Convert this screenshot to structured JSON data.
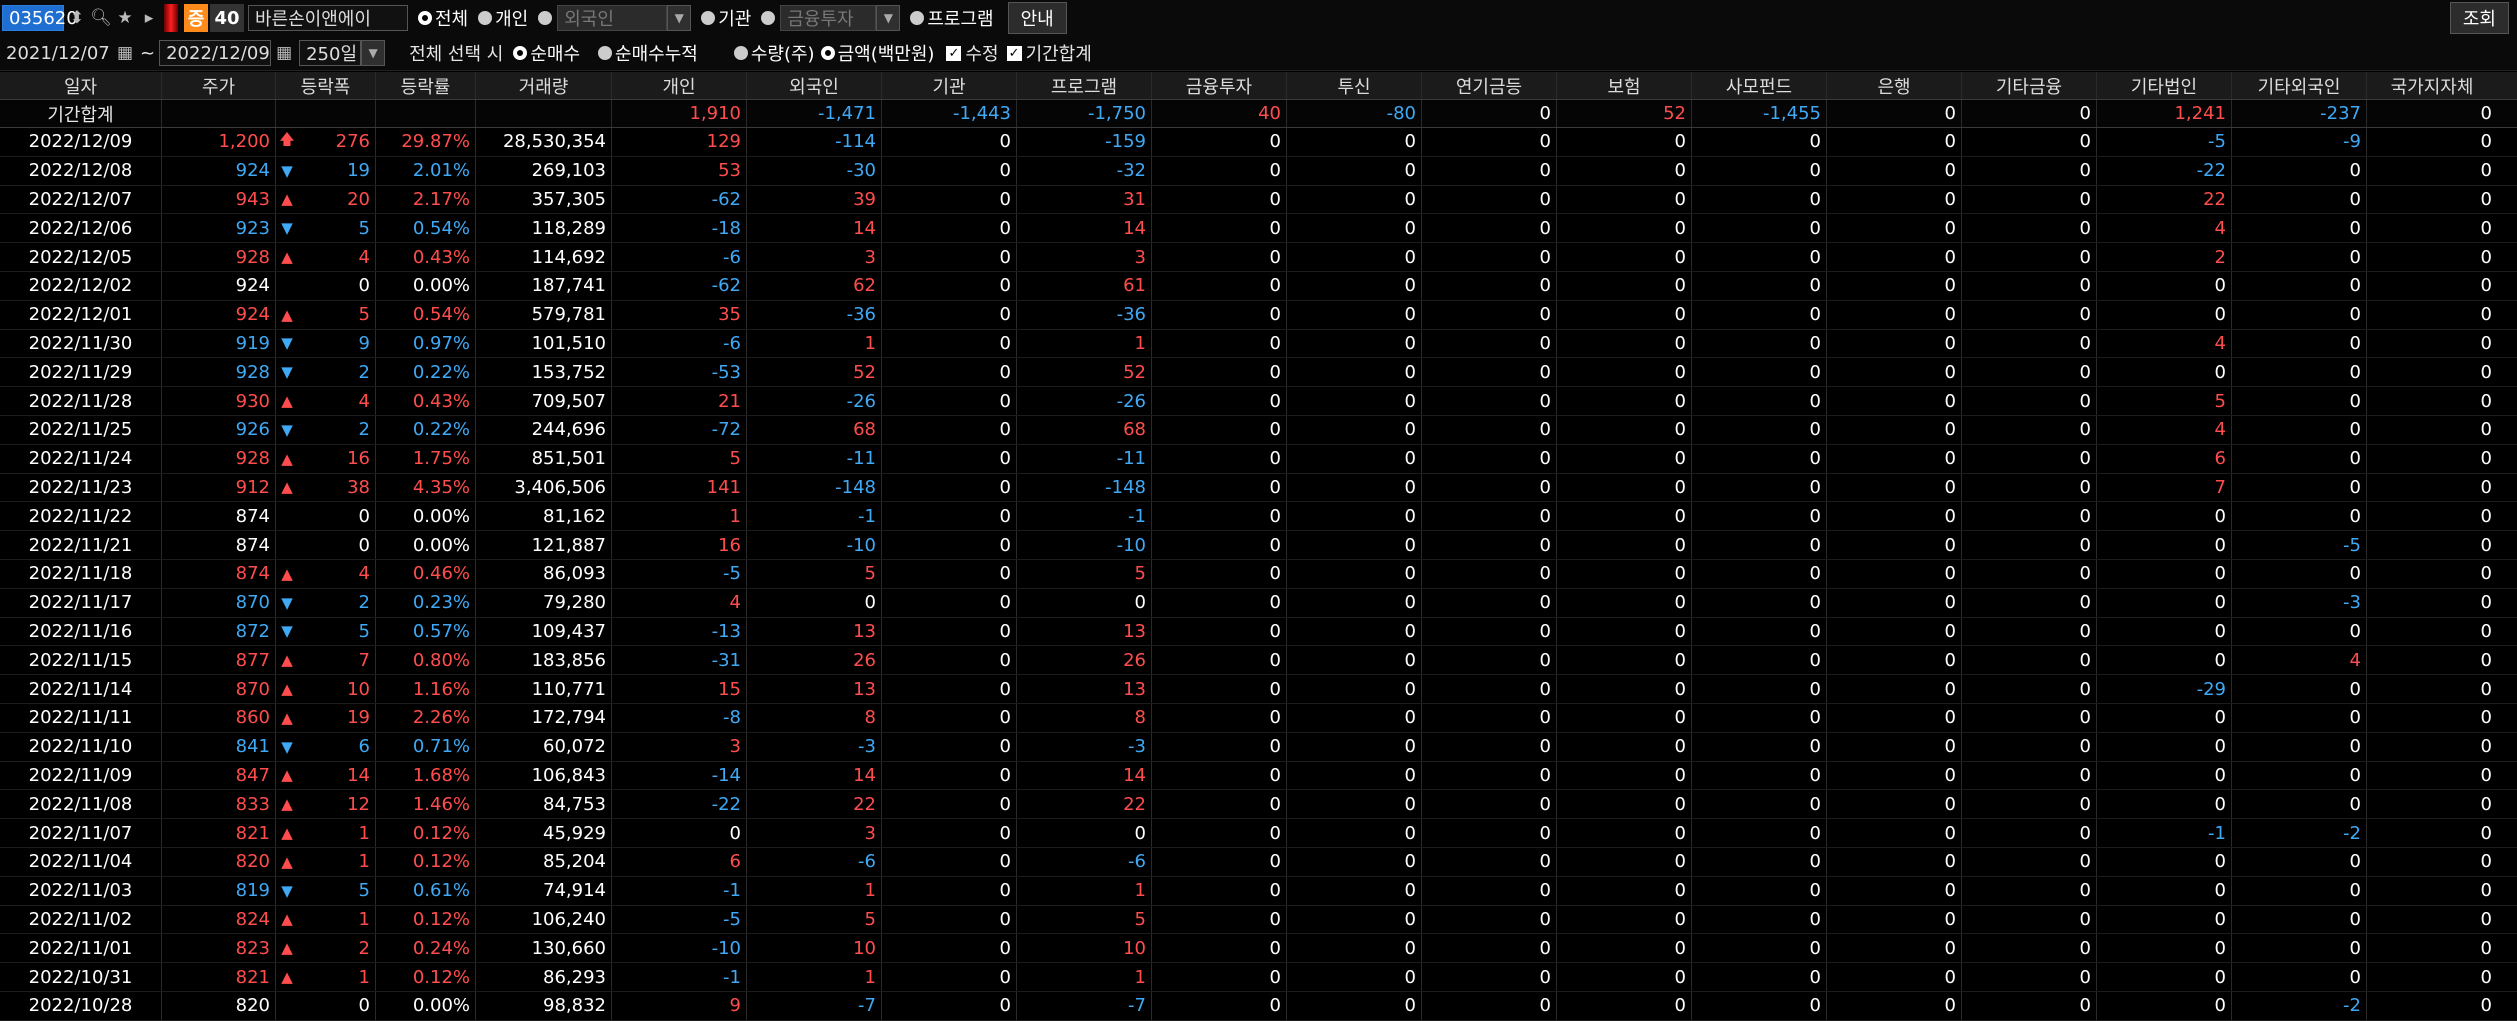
{
  "toolbar": {
    "code": "035620",
    "badge_label": "증",
    "badge_value": "40",
    "stock_name": "바른손이앤에이",
    "investor_options": [
      "전체",
      "개인",
      "외국인",
      "기관",
      "금융투자",
      "프로그램"
    ],
    "selected_investor": "전체",
    "guide_button": "안내",
    "lookup_button": "조회"
  },
  "filters": {
    "start_date": "2021/12/07",
    "date_separator": "~",
    "end_date": "2022/12/09",
    "days": "250일",
    "select_hint": "전체 선택 시",
    "net_options": [
      "순매수",
      "순매수누적"
    ],
    "selected_net": "순매수",
    "unit_options": [
      "수량(주)",
      "금액(백만원)"
    ],
    "selected_unit": "금액(백만원)",
    "checkbox_adjust": "수정",
    "checkbox_period_total": "기간합계"
  },
  "colors": {
    "up": "#ff4d4d",
    "down": "#3fa9f5",
    "flat": "#ffffff"
  },
  "columns": [
    "일자",
    "주가",
    "등락폭",
    "등락률",
    "거래량",
    "개인",
    "외국인",
    "기관",
    "프로그램",
    "금융투자",
    "투신",
    "연기금등",
    "보험",
    "사모펀드",
    "은행",
    "기타금융",
    "기타법인",
    "기타외국인",
    "국가지자체"
  ],
  "summary": {
    "label": "기간합계",
    "values": [
      "1,910",
      "-1,471",
      "-1,443",
      "-1,750",
      "40",
      "-80",
      "0",
      "52",
      "-1,455",
      "0",
      "0",
      "1,241",
      "-237",
      "0"
    ]
  },
  "rows": [
    {
      "date": "2022/12/09",
      "price": "1,200",
      "dir": "limit",
      "change": "276",
      "rate": "29.87%",
      "volume": "28,530,354",
      "inv": [
        "129",
        "-114",
        "0",
        "-159",
        "0",
        "0",
        "0",
        "0",
        "0",
        "0",
        "0",
        "-5",
        "-9",
        "0"
      ]
    },
    {
      "date": "2022/12/08",
      "price": "924",
      "dir": "down",
      "change": "19",
      "rate": "2.01%",
      "volume": "269,103",
      "inv": [
        "53",
        "-30",
        "0",
        "-32",
        "0",
        "0",
        "0",
        "0",
        "0",
        "0",
        "0",
        "-22",
        "0",
        "0"
      ]
    },
    {
      "date": "2022/12/07",
      "price": "943",
      "dir": "up",
      "change": "20",
      "rate": "2.17%",
      "volume": "357,305",
      "inv": [
        "-62",
        "39",
        "0",
        "31",
        "0",
        "0",
        "0",
        "0",
        "0",
        "0",
        "0",
        "22",
        "0",
        "0"
      ]
    },
    {
      "date": "2022/12/06",
      "price": "923",
      "dir": "down",
      "change": "5",
      "rate": "0.54%",
      "volume": "118,289",
      "inv": [
        "-18",
        "14",
        "0",
        "14",
        "0",
        "0",
        "0",
        "0",
        "0",
        "0",
        "0",
        "4",
        "0",
        "0"
      ]
    },
    {
      "date": "2022/12/05",
      "price": "928",
      "dir": "up",
      "change": "4",
      "rate": "0.43%",
      "volume": "114,692",
      "inv": [
        "-6",
        "3",
        "0",
        "3",
        "0",
        "0",
        "0",
        "0",
        "0",
        "0",
        "0",
        "2",
        "0",
        "0"
      ]
    },
    {
      "date": "2022/12/02",
      "price": "924",
      "dir": "flat",
      "change": "0",
      "rate": "0.00%",
      "volume": "187,741",
      "inv": [
        "-62",
        "62",
        "0",
        "61",
        "0",
        "0",
        "0",
        "0",
        "0",
        "0",
        "0",
        "0",
        "0",
        "0"
      ]
    },
    {
      "date": "2022/12/01",
      "price": "924",
      "dir": "up",
      "change": "5",
      "rate": "0.54%",
      "volume": "579,781",
      "inv": [
        "35",
        "-36",
        "0",
        "-36",
        "0",
        "0",
        "0",
        "0",
        "0",
        "0",
        "0",
        "0",
        "0",
        "0"
      ]
    },
    {
      "date": "2022/11/30",
      "price": "919",
      "dir": "down",
      "change": "9",
      "rate": "0.97%",
      "volume": "101,510",
      "inv": [
        "-6",
        "1",
        "0",
        "1",
        "0",
        "0",
        "0",
        "0",
        "0",
        "0",
        "0",
        "4",
        "0",
        "0"
      ]
    },
    {
      "date": "2022/11/29",
      "price": "928",
      "dir": "down",
      "change": "2",
      "rate": "0.22%",
      "volume": "153,752",
      "inv": [
        "-53",
        "52",
        "0",
        "52",
        "0",
        "0",
        "0",
        "0",
        "0",
        "0",
        "0",
        "0",
        "0",
        "0"
      ]
    },
    {
      "date": "2022/11/28",
      "price": "930",
      "dir": "up",
      "change": "4",
      "rate": "0.43%",
      "volume": "709,507",
      "inv": [
        "21",
        "-26",
        "0",
        "-26",
        "0",
        "0",
        "0",
        "0",
        "0",
        "0",
        "0",
        "5",
        "0",
        "0"
      ]
    },
    {
      "date": "2022/11/25",
      "price": "926",
      "dir": "down",
      "change": "2",
      "rate": "0.22%",
      "volume": "244,696",
      "inv": [
        "-72",
        "68",
        "0",
        "68",
        "0",
        "0",
        "0",
        "0",
        "0",
        "0",
        "0",
        "4",
        "0",
        "0"
      ]
    },
    {
      "date": "2022/11/24",
      "price": "928",
      "dir": "up",
      "change": "16",
      "rate": "1.75%",
      "volume": "851,501",
      "inv": [
        "5",
        "-11",
        "0",
        "-11",
        "0",
        "0",
        "0",
        "0",
        "0",
        "0",
        "0",
        "6",
        "0",
        "0"
      ]
    },
    {
      "date": "2022/11/23",
      "price": "912",
      "dir": "up",
      "change": "38",
      "rate": "4.35%",
      "volume": "3,406,506",
      "inv": [
        "141",
        "-148",
        "0",
        "-148",
        "0",
        "0",
        "0",
        "0",
        "0",
        "0",
        "0",
        "7",
        "0",
        "0"
      ]
    },
    {
      "date": "2022/11/22",
      "price": "874",
      "dir": "flat",
      "change": "0",
      "rate": "0.00%",
      "volume": "81,162",
      "inv": [
        "1",
        "-1",
        "0",
        "-1",
        "0",
        "0",
        "0",
        "0",
        "0",
        "0",
        "0",
        "0",
        "0",
        "0"
      ]
    },
    {
      "date": "2022/11/21",
      "price": "874",
      "dir": "flat",
      "change": "0",
      "rate": "0.00%",
      "volume": "121,887",
      "inv": [
        "16",
        "-10",
        "0",
        "-10",
        "0",
        "0",
        "0",
        "0",
        "0",
        "0",
        "0",
        "0",
        "-5",
        "0"
      ]
    },
    {
      "date": "2022/11/18",
      "price": "874",
      "dir": "up",
      "change": "4",
      "rate": "0.46%",
      "volume": "86,093",
      "inv": [
        "-5",
        "5",
        "0",
        "5",
        "0",
        "0",
        "0",
        "0",
        "0",
        "0",
        "0",
        "0",
        "0",
        "0"
      ]
    },
    {
      "date": "2022/11/17",
      "price": "870",
      "dir": "down",
      "change": "2",
      "rate": "0.23%",
      "volume": "79,280",
      "inv": [
        "4",
        "0",
        "0",
        "0",
        "0",
        "0",
        "0",
        "0",
        "0",
        "0",
        "0",
        "0",
        "-3",
        "0"
      ]
    },
    {
      "date": "2022/11/16",
      "price": "872",
      "dir": "down",
      "change": "5",
      "rate": "0.57%",
      "volume": "109,437",
      "inv": [
        "-13",
        "13",
        "0",
        "13",
        "0",
        "0",
        "0",
        "0",
        "0",
        "0",
        "0",
        "0",
        "0",
        "0"
      ]
    },
    {
      "date": "2022/11/15",
      "price": "877",
      "dir": "up",
      "change": "7",
      "rate": "0.80%",
      "volume": "183,856",
      "inv": [
        "-31",
        "26",
        "0",
        "26",
        "0",
        "0",
        "0",
        "0",
        "0",
        "0",
        "0",
        "0",
        "4",
        "0"
      ]
    },
    {
      "date": "2022/11/14",
      "price": "870",
      "dir": "up",
      "change": "10",
      "rate": "1.16%",
      "volume": "110,771",
      "inv": [
        "15",
        "13",
        "0",
        "13",
        "0",
        "0",
        "0",
        "0",
        "0",
        "0",
        "0",
        "-29",
        "0",
        "0"
      ]
    },
    {
      "date": "2022/11/11",
      "price": "860",
      "dir": "up",
      "change": "19",
      "rate": "2.26%",
      "volume": "172,794",
      "inv": [
        "-8",
        "8",
        "0",
        "8",
        "0",
        "0",
        "0",
        "0",
        "0",
        "0",
        "0",
        "0",
        "0",
        "0"
      ]
    },
    {
      "date": "2022/11/10",
      "price": "841",
      "dir": "down",
      "change": "6",
      "rate": "0.71%",
      "volume": "60,072",
      "inv": [
        "3",
        "-3",
        "0",
        "-3",
        "0",
        "0",
        "0",
        "0",
        "0",
        "0",
        "0",
        "0",
        "0",
        "0"
      ]
    },
    {
      "date": "2022/11/09",
      "price": "847",
      "dir": "up",
      "change": "14",
      "rate": "1.68%",
      "volume": "106,843",
      "inv": [
        "-14",
        "14",
        "0",
        "14",
        "0",
        "0",
        "0",
        "0",
        "0",
        "0",
        "0",
        "0",
        "0",
        "0"
      ]
    },
    {
      "date": "2022/11/08",
      "price": "833",
      "dir": "up",
      "change": "12",
      "rate": "1.46%",
      "volume": "84,753",
      "inv": [
        "-22",
        "22",
        "0",
        "22",
        "0",
        "0",
        "0",
        "0",
        "0",
        "0",
        "0",
        "0",
        "0",
        "0"
      ]
    },
    {
      "date": "2022/11/07",
      "price": "821",
      "dir": "up",
      "change": "1",
      "rate": "0.12%",
      "volume": "45,929",
      "inv": [
        "0",
        "3",
        "0",
        "0",
        "0",
        "0",
        "0",
        "0",
        "0",
        "0",
        "0",
        "-1",
        "-2",
        "0"
      ]
    },
    {
      "date": "2022/11/04",
      "price": "820",
      "dir": "up",
      "change": "1",
      "rate": "0.12%",
      "volume": "85,204",
      "inv": [
        "6",
        "-6",
        "0",
        "-6",
        "0",
        "0",
        "0",
        "0",
        "0",
        "0",
        "0",
        "0",
        "0",
        "0"
      ]
    },
    {
      "date": "2022/11/03",
      "price": "819",
      "dir": "down",
      "change": "5",
      "rate": "0.61%",
      "volume": "74,914",
      "inv": [
        "-1",
        "1",
        "0",
        "1",
        "0",
        "0",
        "0",
        "0",
        "0",
        "0",
        "0",
        "0",
        "0",
        "0"
      ]
    },
    {
      "date": "2022/11/02",
      "price": "824",
      "dir": "up",
      "change": "1",
      "rate": "0.12%",
      "volume": "106,240",
      "inv": [
        "-5",
        "5",
        "0",
        "5",
        "0",
        "0",
        "0",
        "0",
        "0",
        "0",
        "0",
        "0",
        "0",
        "0"
      ]
    },
    {
      "date": "2022/11/01",
      "price": "823",
      "dir": "up",
      "change": "2",
      "rate": "0.24%",
      "volume": "130,660",
      "inv": [
        "-10",
        "10",
        "0",
        "10",
        "0",
        "0",
        "0",
        "0",
        "0",
        "0",
        "0",
        "0",
        "0",
        "0"
      ]
    },
    {
      "date": "2022/10/31",
      "price": "821",
      "dir": "up",
      "change": "1",
      "rate": "0.12%",
      "volume": "86,293",
      "inv": [
        "-1",
        "1",
        "0",
        "1",
        "0",
        "0",
        "0",
        "0",
        "0",
        "0",
        "0",
        "0",
        "0",
        "0"
      ]
    },
    {
      "date": "2022/10/28",
      "price": "820",
      "dir": "flat",
      "change": "0",
      "rate": "0.00%",
      "volume": "98,832",
      "inv": [
        "9",
        "-7",
        "0",
        "-7",
        "0",
        "0",
        "0",
        "0",
        "0",
        "0",
        "0",
        "0",
        "-2",
        "0"
      ]
    }
  ]
}
